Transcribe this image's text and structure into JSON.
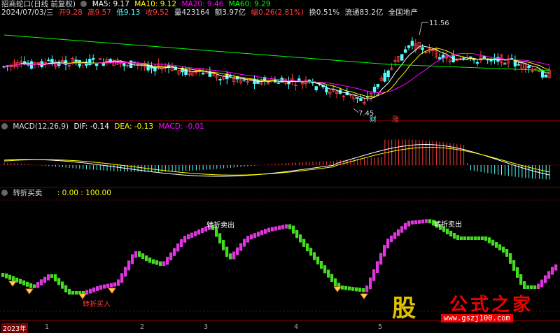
{
  "header": {
    "stock_name": "招商蛇口(日线 前复权)",
    "ma5": "MA5: 9.17",
    "ma10": "MA10: 9.12",
    "ma20": "MA20: 9.46",
    "ma60": "MA60: 9.29"
  },
  "date_line": {
    "date": "2024/07/03/三",
    "open": "开9.28",
    "high": "高9.57",
    "low": "低9.13",
    "close": "收9.52",
    "volume": "量423164",
    "amount": "额3.97亿",
    "change": "幅0.26(2.81%)",
    "turnover": "换0.51%",
    "float": "流通83.2亿",
    "sector": "全国地产"
  },
  "price_annotations": {
    "high_label": "11.56",
    "low_label": "7.45",
    "badge_1": "财",
    "badge_2": "涨"
  },
  "macd": {
    "title": "MACD(12,26,9)",
    "dif": "DIF: -0.14",
    "dea": "DEA: -0.13",
    "macd": "MACD: -0.01"
  },
  "indicator": {
    "title": "转折买卖",
    "values": ": 0.00 : 100.00",
    "sell_label_1": "转折卖出",
    "sell_label_2": "转折卖出",
    "buy_label": "转折买入"
  },
  "x_axis": [
    "2023年",
    "1",
    "2",
    "3",
    "4",
    "5"
  ],
  "watermark": {
    "big": "股",
    "text": "公式之家",
    "url": "www.gszj100.com"
  },
  "colors": {
    "up": "#ff3b3b",
    "down": "#54ffff",
    "ma5": "#ffffff",
    "ma10": "#ffff00",
    "ma20": "#ff00ff",
    "ma60": "#00ff00",
    "ind_up": "#e036e0",
    "ind_down": "#44dd22"
  }
}
